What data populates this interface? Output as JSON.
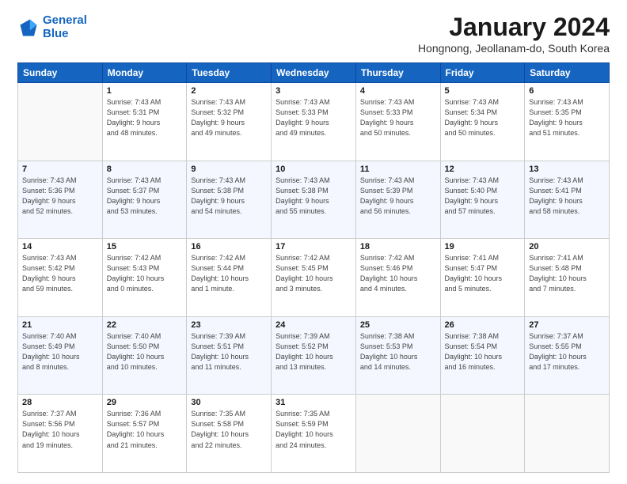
{
  "logo": {
    "line1": "General",
    "line2": "Blue"
  },
  "title": "January 2024",
  "location": "Hongnong, Jeollanam-do, South Korea",
  "weekdays": [
    "Sunday",
    "Monday",
    "Tuesday",
    "Wednesday",
    "Thursday",
    "Friday",
    "Saturday"
  ],
  "weeks": [
    [
      {
        "day": "",
        "info": ""
      },
      {
        "day": "1",
        "info": "Sunrise: 7:43 AM\nSunset: 5:31 PM\nDaylight: 9 hours\nand 48 minutes."
      },
      {
        "day": "2",
        "info": "Sunrise: 7:43 AM\nSunset: 5:32 PM\nDaylight: 9 hours\nand 49 minutes."
      },
      {
        "day": "3",
        "info": "Sunrise: 7:43 AM\nSunset: 5:33 PM\nDaylight: 9 hours\nand 49 minutes."
      },
      {
        "day": "4",
        "info": "Sunrise: 7:43 AM\nSunset: 5:33 PM\nDaylight: 9 hours\nand 50 minutes."
      },
      {
        "day": "5",
        "info": "Sunrise: 7:43 AM\nSunset: 5:34 PM\nDaylight: 9 hours\nand 50 minutes."
      },
      {
        "day": "6",
        "info": "Sunrise: 7:43 AM\nSunset: 5:35 PM\nDaylight: 9 hours\nand 51 minutes."
      }
    ],
    [
      {
        "day": "7",
        "info": "Sunrise: 7:43 AM\nSunset: 5:36 PM\nDaylight: 9 hours\nand 52 minutes."
      },
      {
        "day": "8",
        "info": "Sunrise: 7:43 AM\nSunset: 5:37 PM\nDaylight: 9 hours\nand 53 minutes."
      },
      {
        "day": "9",
        "info": "Sunrise: 7:43 AM\nSunset: 5:38 PM\nDaylight: 9 hours\nand 54 minutes."
      },
      {
        "day": "10",
        "info": "Sunrise: 7:43 AM\nSunset: 5:38 PM\nDaylight: 9 hours\nand 55 minutes."
      },
      {
        "day": "11",
        "info": "Sunrise: 7:43 AM\nSunset: 5:39 PM\nDaylight: 9 hours\nand 56 minutes."
      },
      {
        "day": "12",
        "info": "Sunrise: 7:43 AM\nSunset: 5:40 PM\nDaylight: 9 hours\nand 57 minutes."
      },
      {
        "day": "13",
        "info": "Sunrise: 7:43 AM\nSunset: 5:41 PM\nDaylight: 9 hours\nand 58 minutes."
      }
    ],
    [
      {
        "day": "14",
        "info": "Sunrise: 7:43 AM\nSunset: 5:42 PM\nDaylight: 9 hours\nand 59 minutes."
      },
      {
        "day": "15",
        "info": "Sunrise: 7:42 AM\nSunset: 5:43 PM\nDaylight: 10 hours\nand 0 minutes."
      },
      {
        "day": "16",
        "info": "Sunrise: 7:42 AM\nSunset: 5:44 PM\nDaylight: 10 hours\nand 1 minute."
      },
      {
        "day": "17",
        "info": "Sunrise: 7:42 AM\nSunset: 5:45 PM\nDaylight: 10 hours\nand 3 minutes."
      },
      {
        "day": "18",
        "info": "Sunrise: 7:42 AM\nSunset: 5:46 PM\nDaylight: 10 hours\nand 4 minutes."
      },
      {
        "day": "19",
        "info": "Sunrise: 7:41 AM\nSunset: 5:47 PM\nDaylight: 10 hours\nand 5 minutes."
      },
      {
        "day": "20",
        "info": "Sunrise: 7:41 AM\nSunset: 5:48 PM\nDaylight: 10 hours\nand 7 minutes."
      }
    ],
    [
      {
        "day": "21",
        "info": "Sunrise: 7:40 AM\nSunset: 5:49 PM\nDaylight: 10 hours\nand 8 minutes."
      },
      {
        "day": "22",
        "info": "Sunrise: 7:40 AM\nSunset: 5:50 PM\nDaylight: 10 hours\nand 10 minutes."
      },
      {
        "day": "23",
        "info": "Sunrise: 7:39 AM\nSunset: 5:51 PM\nDaylight: 10 hours\nand 11 minutes."
      },
      {
        "day": "24",
        "info": "Sunrise: 7:39 AM\nSunset: 5:52 PM\nDaylight: 10 hours\nand 13 minutes."
      },
      {
        "day": "25",
        "info": "Sunrise: 7:38 AM\nSunset: 5:53 PM\nDaylight: 10 hours\nand 14 minutes."
      },
      {
        "day": "26",
        "info": "Sunrise: 7:38 AM\nSunset: 5:54 PM\nDaylight: 10 hours\nand 16 minutes."
      },
      {
        "day": "27",
        "info": "Sunrise: 7:37 AM\nSunset: 5:55 PM\nDaylight: 10 hours\nand 17 minutes."
      }
    ],
    [
      {
        "day": "28",
        "info": "Sunrise: 7:37 AM\nSunset: 5:56 PM\nDaylight: 10 hours\nand 19 minutes."
      },
      {
        "day": "29",
        "info": "Sunrise: 7:36 AM\nSunset: 5:57 PM\nDaylight: 10 hours\nand 21 minutes."
      },
      {
        "day": "30",
        "info": "Sunrise: 7:35 AM\nSunset: 5:58 PM\nDaylight: 10 hours\nand 22 minutes."
      },
      {
        "day": "31",
        "info": "Sunrise: 7:35 AM\nSunset: 5:59 PM\nDaylight: 10 hours\nand 24 minutes."
      },
      {
        "day": "",
        "info": ""
      },
      {
        "day": "",
        "info": ""
      },
      {
        "day": "",
        "info": ""
      }
    ]
  ]
}
